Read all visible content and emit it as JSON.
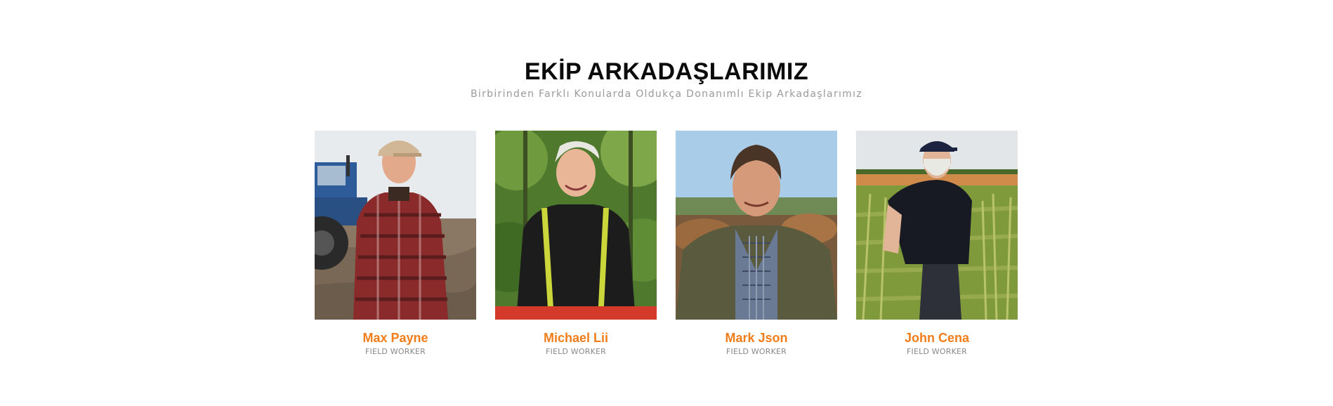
{
  "section": {
    "title": "EKİP ARKADAŞLARIMIZ",
    "subtitle": "Birbirinden Farklı Konularda Oldukça Donanımlı Ekip Arkadaşlarımız"
  },
  "team": [
    {
      "name": "Max Payne",
      "role": "FIELD WORKER"
    },
    {
      "name": "Michael Lii",
      "role": "FIELD WORKER"
    },
    {
      "name": "Mark Json",
      "role": "FIELD WORKER"
    },
    {
      "name": "John Cena",
      "role": "FIELD WORKER"
    }
  ],
  "colors": {
    "title": "#0b0b0b",
    "subtitle": "#9a9a9a",
    "accent_name": "#f07d1a",
    "role": "#888888",
    "background": "#ffffff"
  }
}
